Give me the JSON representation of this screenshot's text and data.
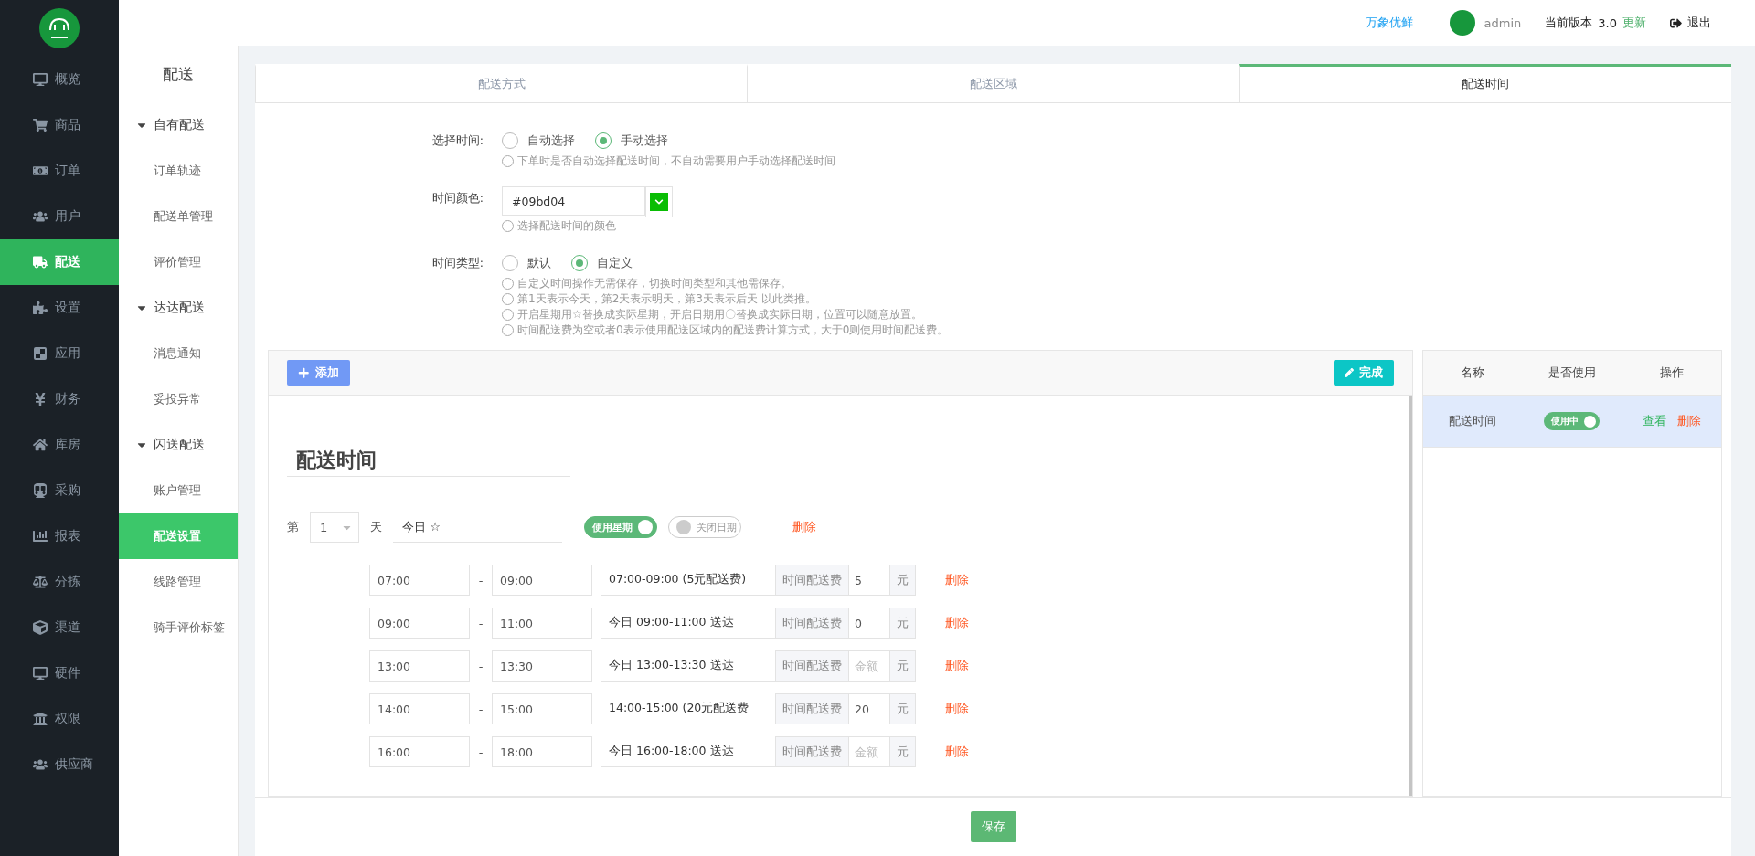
{
  "topbar": {
    "brand": "万象优鲜",
    "user": "admin",
    "version_label": "当前版本",
    "version": "3.0",
    "update": "更新",
    "logout": "退出"
  },
  "nav": [
    {
      "label": "概览",
      "selected": false
    },
    {
      "label": "商品",
      "selected": false
    },
    {
      "label": "订单",
      "selected": false
    },
    {
      "label": "用户",
      "selected": false
    },
    {
      "label": "配送",
      "selected": true
    },
    {
      "label": "设置",
      "selected": false
    },
    {
      "label": "应用",
      "selected": false
    },
    {
      "label": "财务",
      "selected": false
    },
    {
      "label": "库房",
      "selected": false
    },
    {
      "label": "采购",
      "selected": false
    },
    {
      "label": "报表",
      "selected": false
    },
    {
      "label": "分拣",
      "selected": false
    },
    {
      "label": "渠道",
      "selected": false
    },
    {
      "label": "硬件",
      "selected": false
    },
    {
      "label": "权限",
      "selected": false
    },
    {
      "label": "供应商",
      "selected": false
    }
  ],
  "subnav": {
    "title": "配送",
    "groups": [
      {
        "label": "自有配送",
        "expanded": true,
        "children": [
          {
            "label": "订单轨迹",
            "selected": false
          },
          {
            "label": "配送单管理",
            "selected": false
          },
          {
            "label": "评价管理",
            "selected": false
          }
        ]
      },
      {
        "label": "达达配送",
        "expanded": true,
        "children": [
          {
            "label": "消息通知",
            "selected": false
          },
          {
            "label": "妥投异常",
            "selected": false
          }
        ]
      },
      {
        "label": "闪送配送",
        "expanded": true,
        "children": [
          {
            "label": "账户管理",
            "selected": false
          },
          {
            "label": "配送设置",
            "selected": true
          },
          {
            "label": "线路管理",
            "selected": false
          },
          {
            "label": "骑手评价标签",
            "selected": false
          }
        ]
      }
    ]
  },
  "tabs": [
    {
      "label": "配送方式",
      "selected": false
    },
    {
      "label": "配送区域",
      "selected": false
    },
    {
      "label": "配送时间",
      "selected": true
    }
  ],
  "form": [
    {
      "kind": "radio",
      "label": "选择时间:",
      "options": [
        {
          "label": "自动选择",
          "selected": false
        },
        {
          "label": "手动选择",
          "selected": true
        }
      ],
      "hints": [
        "下单时是否自动选择配送时间，不自动需要用户手动选择配送时间"
      ]
    },
    {
      "kind": "color",
      "label": "时间颜色:",
      "value": "#09bd04",
      "color": "#09bd04",
      "hints": [
        "选择配送时间的颜色"
      ]
    },
    {
      "kind": "radio",
      "label": "时间类型:",
      "options": [
        {
          "label": "默认",
          "selected": false
        },
        {
          "label": "自定义",
          "selected": true
        }
      ],
      "hints": [
        "自定义时间操作无需保存，切换时间类型和其他需保存。",
        "第1天表示今天，第2天表示明天，第3天表示后天 以此类推。",
        "开启星期用☆替换成实际星期，开启日期用〇替换成实际日期，位置可以随意放置。",
        "时间配送费为空或者0表示使用配送区域内的配送费计算方式，大于0则使用时间配送费。"
      ]
    }
  ],
  "editor": {
    "add": "添加",
    "done": "完成",
    "title": "配送时间",
    "day": {
      "prefix": "第",
      "number": "1",
      "suffix": "天",
      "name": "今日 ☆",
      "toggles": [
        {
          "label": "使用星期",
          "on": true
        },
        {
          "label": "关闭日期",
          "on": false
        }
      ],
      "delete": "删除"
    },
    "slots": [
      {
        "start": "07:00",
        "separator": "-",
        "end": "09:00",
        "text": "07:00-09:00 (5元配送费)",
        "fee_label": "时间配送费",
        "fee": "5",
        "unit": "元",
        "delete": "删除"
      },
      {
        "start": "09:00",
        "separator": "-",
        "end": "11:00",
        "text": "今日 09:00-11:00 送达",
        "fee_label": "时间配送费",
        "fee": "0",
        "unit": "元",
        "delete": "删除"
      },
      {
        "start": "13:00",
        "separator": "-",
        "end": "13:30",
        "text": "今日 13:00-13:30 送达",
        "fee_label": "时间配送费",
        "fee_placeholder": "金额",
        "unit": "元",
        "delete": "删除"
      },
      {
        "start": "14:00",
        "separator": "-",
        "end": "15:00",
        "text": "14:00-15:00 (20元配送费",
        "fee_label": "时间配送费",
        "fee": "20",
        "unit": "元",
        "delete": "删除"
      },
      {
        "start": "16:00",
        "separator": "-",
        "end": "18:00",
        "text": "今日 16:00-18:00 送达",
        "fee_label": "时间配送费",
        "fee_placeholder": "金额",
        "unit": "元",
        "delete": "删除"
      }
    ]
  },
  "list": {
    "columns": [
      "名称",
      "是否使用",
      "操作"
    ],
    "rows": [
      {
        "name": "配送时间",
        "selected": true,
        "status": "使用中",
        "on": true,
        "view": "查看",
        "delete": "删除"
      }
    ]
  },
  "save": "保存"
}
